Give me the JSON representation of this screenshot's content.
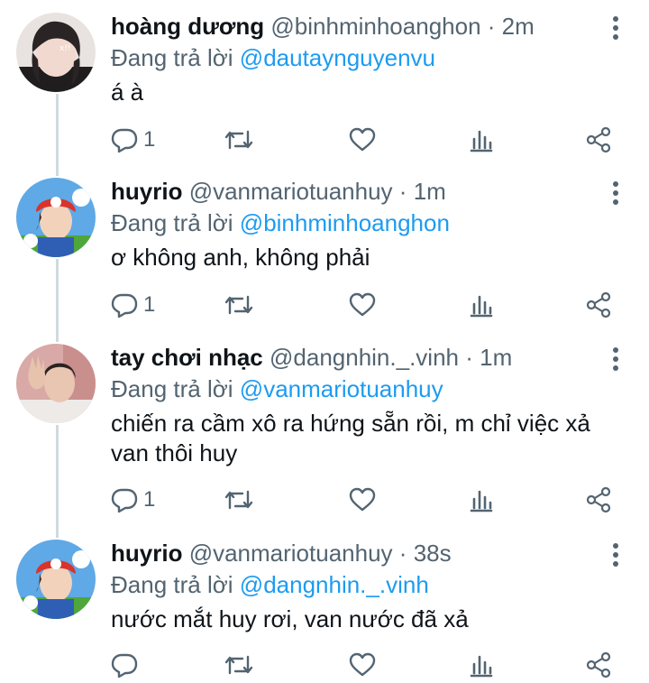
{
  "tweets": [
    {
      "name": "hoàng dương",
      "handle": "@binhminhoanghon",
      "separator": "·",
      "time": "2m",
      "reply_prefix": "Đang trả lời",
      "reply_to": "@dautaynguyenvu",
      "text": "á à",
      "reply_count": "1",
      "avatar_icon": "avatar-photo-person-dark-hair",
      "colors": {
        "bg": "#e9e4e2",
        "fg": "#2b2726"
      }
    },
    {
      "name": "huyrio",
      "handle": "@vanmariotuanhuy",
      "separator": "·",
      "time": "1m",
      "reply_prefix": "Đang trả lời",
      "reply_to": "@binhminhoanghon",
      "text": "ơ không anh, không phải",
      "reply_count": "1",
      "avatar_icon": "avatar-mario-costume",
      "colors": {
        "bg": "#5aa7e8",
        "fg": "#d9342b"
      }
    },
    {
      "name": "tay chơi nhạc",
      "handle": "@dangnhin._.vinh",
      "separator": "·",
      "time": "1m",
      "reply_prefix": "Đang trả lời",
      "reply_to": "@vanmariotuanhuy",
      "text": "chiến ra cầm xô ra hứng sẵn rồi, m chỉ việc xả van thôi huy",
      "reply_count": "1",
      "avatar_icon": "avatar-photo-person-waving",
      "colors": {
        "bg": "#d9a7a5",
        "fg": "#2b2321"
      }
    },
    {
      "name": "huyrio",
      "handle": "@vanmariotuanhuy",
      "separator": "·",
      "time": "38s",
      "reply_prefix": "Đang trả lời",
      "reply_to": "@dangnhin._.vinh",
      "text": "nước mắt huy rơi, van nước đã xả",
      "reply_count": "",
      "avatar_icon": "avatar-mario-costume",
      "colors": {
        "bg": "#5aa7e8",
        "fg": "#d9342b"
      }
    }
  ],
  "colors": {
    "text": "#0f1419",
    "secondary": "#536471",
    "mention": "#1d9bf0",
    "thread_line": "#cfd9de"
  },
  "icons": [
    "reply-icon",
    "retweet-icon",
    "like-icon",
    "analytics-icon",
    "share-icon",
    "more-options-icon"
  ]
}
